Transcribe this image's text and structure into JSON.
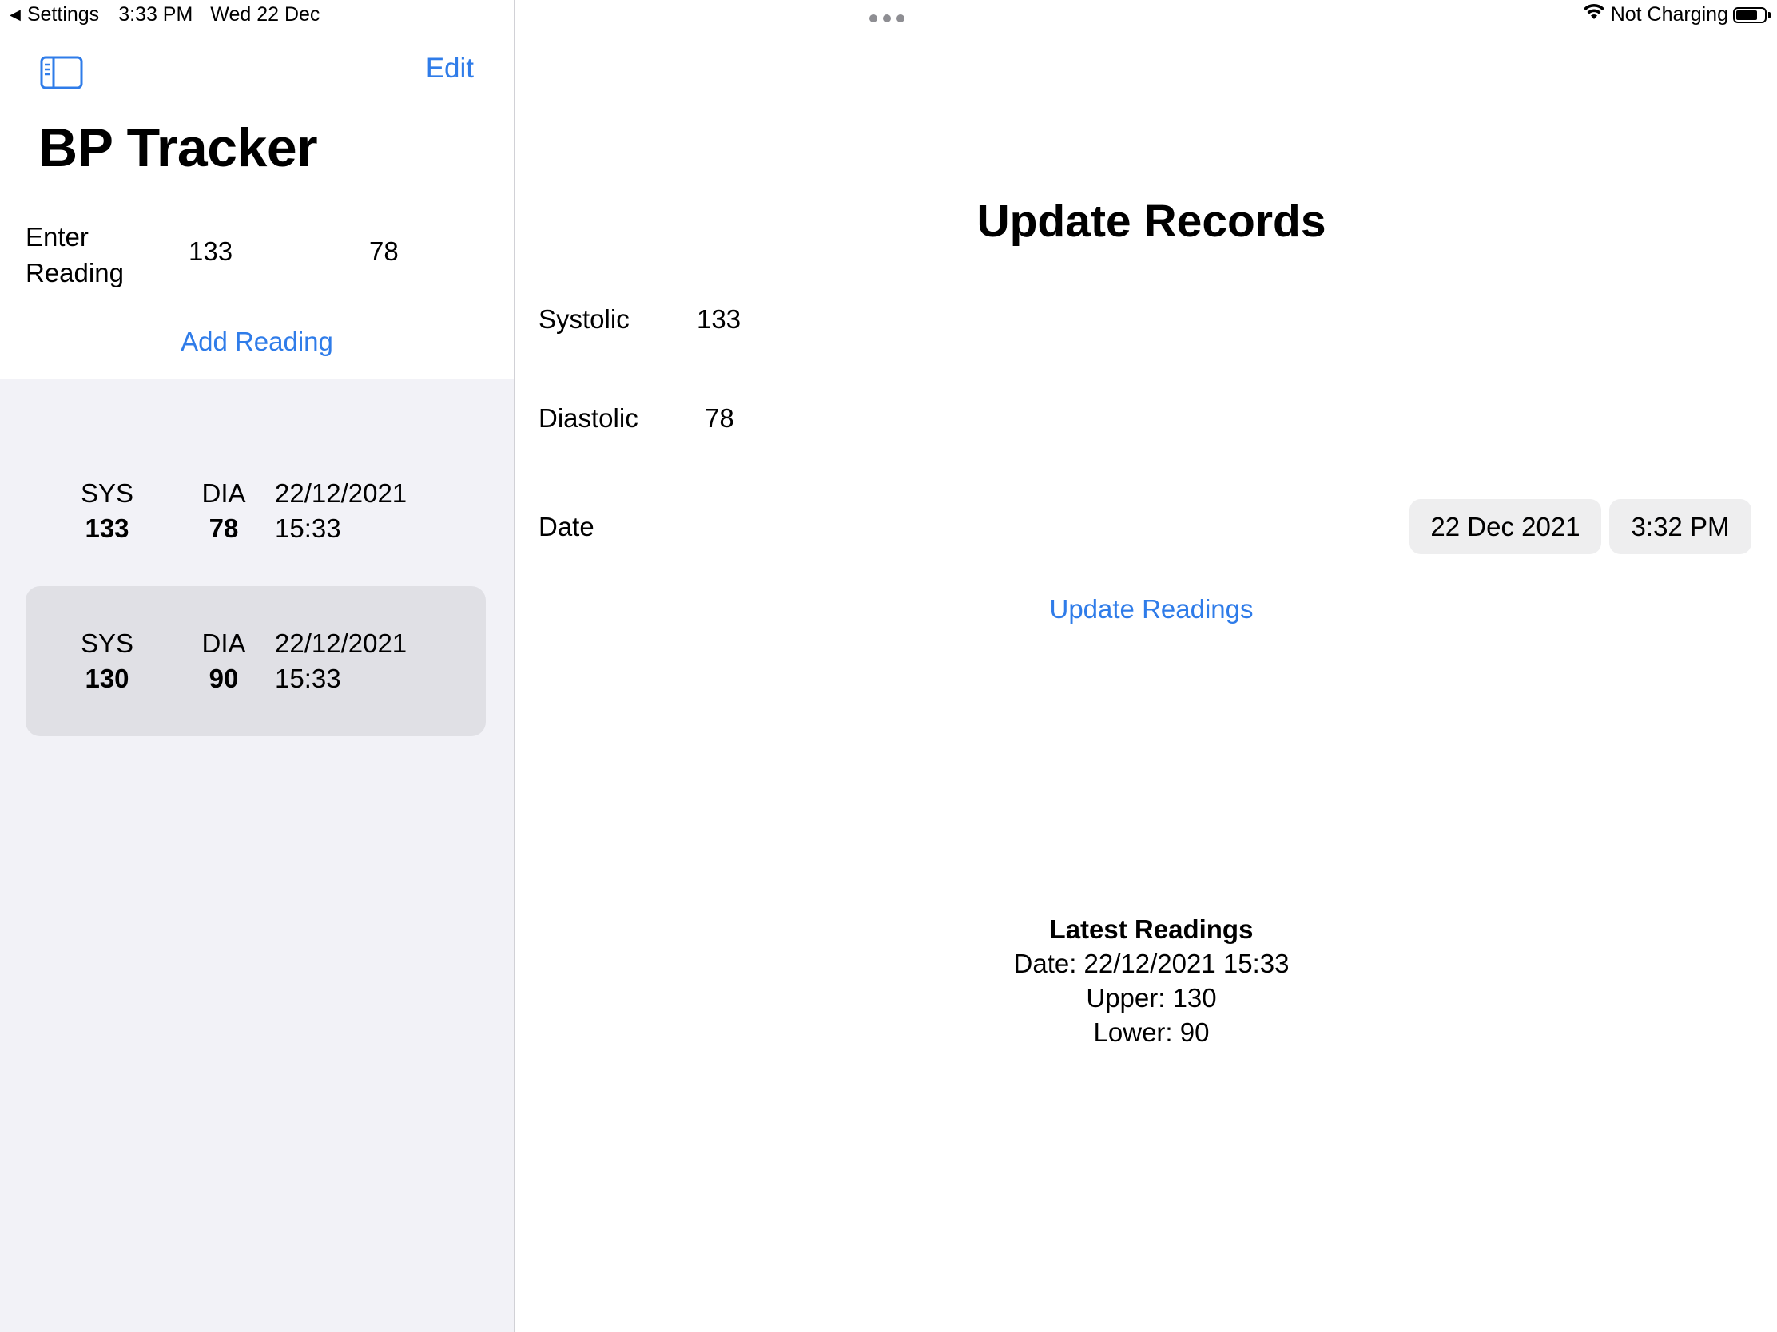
{
  "status_bar": {
    "back_app": "Settings",
    "time": "3:33 PM",
    "date": "Wed 22 Dec",
    "charging": "Not Charging",
    "battery_level": 0.8
  },
  "sidebar": {
    "edit_label": "Edit",
    "title": "BP Tracker",
    "enter_label": "Enter Reading",
    "systolic_input": "133",
    "diastolic_input": "78",
    "add_label": "Add Reading",
    "readings": [
      {
        "sys_label": "SYS",
        "sys": "133",
        "dia_label": "DIA",
        "dia": "78",
        "date": "22/12/2021",
        "time": "15:33"
      },
      {
        "sys_label": "SYS",
        "sys": "130",
        "dia_label": "DIA",
        "dia": "90",
        "date": "22/12/2021",
        "time": "15:33"
      }
    ]
  },
  "detail": {
    "title": "Update Records",
    "systolic_label": "Systolic",
    "systolic_value": "133",
    "diastolic_label": "Diastolic",
    "diastolic_value": "78",
    "date_label": "Date",
    "date_value": "22 Dec 2021",
    "time_value": "3:32 PM",
    "update_label": "Update Readings",
    "latest": {
      "title": "Latest Readings",
      "date_line": "Date: 22/12/2021 15:33",
      "upper_line": "Upper: 130",
      "lower_line": "Lower: 90"
    }
  },
  "colors": {
    "accent": "#2f7ce9",
    "sidebar_bg": "#f2f2f7",
    "selected_row": "#e0e0e5",
    "pill_bg": "#eeeeef"
  },
  "icons": {
    "sidebar_toggle": "sidebar-toggle-icon",
    "wifi": "wifi-icon",
    "battery": "battery-icon",
    "back": "back-arrow-icon",
    "more": "more-dots-icon"
  }
}
